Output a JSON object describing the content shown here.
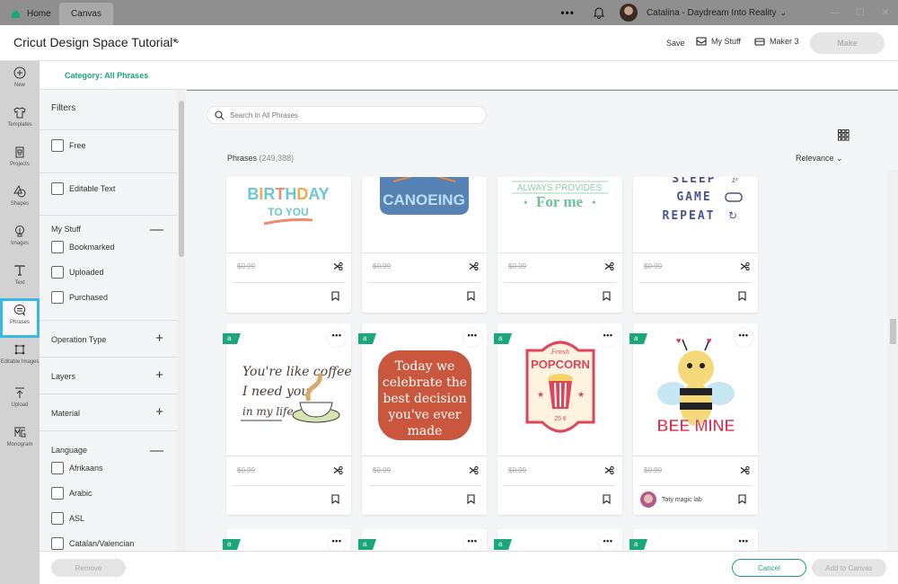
{
  "titlebar": {
    "tabs": [
      {
        "label": "Home",
        "icon": "home-icon"
      },
      {
        "label": "Canvas"
      }
    ],
    "more_label": "•••",
    "user_name": "Catalina - Daydream Into Reality",
    "window_controls": [
      "—",
      "☐",
      "✕"
    ]
  },
  "header": {
    "project_title": "Cricut Design Space Tutorial*",
    "save_label": "Save",
    "mystuff_label": "My Stuff",
    "machine_label": "Maker 3",
    "make_label": "Make"
  },
  "rail": {
    "items": [
      {
        "label": "New",
        "icon": "plus-circle-icon"
      },
      {
        "label": "Templates",
        "icon": "tshirt-icon"
      },
      {
        "label": "Projects",
        "icon": "projects-icon"
      },
      {
        "label": "Shapes",
        "icon": "shapes-icon"
      },
      {
        "label": "Images",
        "icon": "lightbulb-icon"
      },
      {
        "label": "Text",
        "icon": "text-icon"
      },
      {
        "label": "Phrases",
        "icon": "speech-bubble-icon",
        "active": true
      },
      {
        "label": "Editable Images",
        "icon": "editable-images-icon"
      },
      {
        "label": "Upload",
        "icon": "upload-icon"
      },
      {
        "label": "Monogram",
        "icon": "monogram-icon"
      }
    ],
    "tooltip": "Phrases"
  },
  "category": {
    "label": "Category: All Phrases"
  },
  "filters": {
    "title": "Filters",
    "free_label": "Free",
    "editable_text_label": "Editable Text",
    "mystuff": {
      "title": "My Stuff",
      "options": [
        "Bookmarked",
        "Uploaded",
        "Purchased"
      ]
    },
    "operation_type": "Operation Type",
    "layers": "Layers",
    "material": "Material",
    "language": {
      "title": "Language",
      "options": [
        "Afrikaans",
        "Arabic",
        "ASL",
        "Catalan/Valencian"
      ]
    }
  },
  "main": {
    "search_placeholder": "Search in All Phrases",
    "results_label": "Phrases",
    "results_count": "(249,388)",
    "sort_label": "Relevance",
    "cards_row1": [
      {
        "title": "Happy Birthday To You",
        "price": "$0.99"
      },
      {
        "title": "Canoeing",
        "price": "$0.99"
      },
      {
        "title": "Always Provides For Me",
        "price": "$0.99"
      },
      {
        "title": "Sleep Game Repeat",
        "price": "$0.99"
      }
    ],
    "cards_row2": [
      {
        "title": "You're like coffee, I need you in my life",
        "price": "$0.99"
      },
      {
        "title": "Today we celebrate the best decision you've ever made",
        "price": "$0.99"
      },
      {
        "title": "Fresh Popcorn 25 ¢",
        "price": "$0.99"
      },
      {
        "title": "Bee Mine",
        "price": "$0.99",
        "author": "Taty magic lab"
      }
    ],
    "badge_label": "a",
    "more_label": "•••"
  },
  "footer": {
    "remove_label": "Remove",
    "cancel_label": "Cancel",
    "add_label": "Add to Canvas"
  },
  "colors": {
    "accent": "#1aa77a",
    "highlight": "#3ab7ea"
  }
}
